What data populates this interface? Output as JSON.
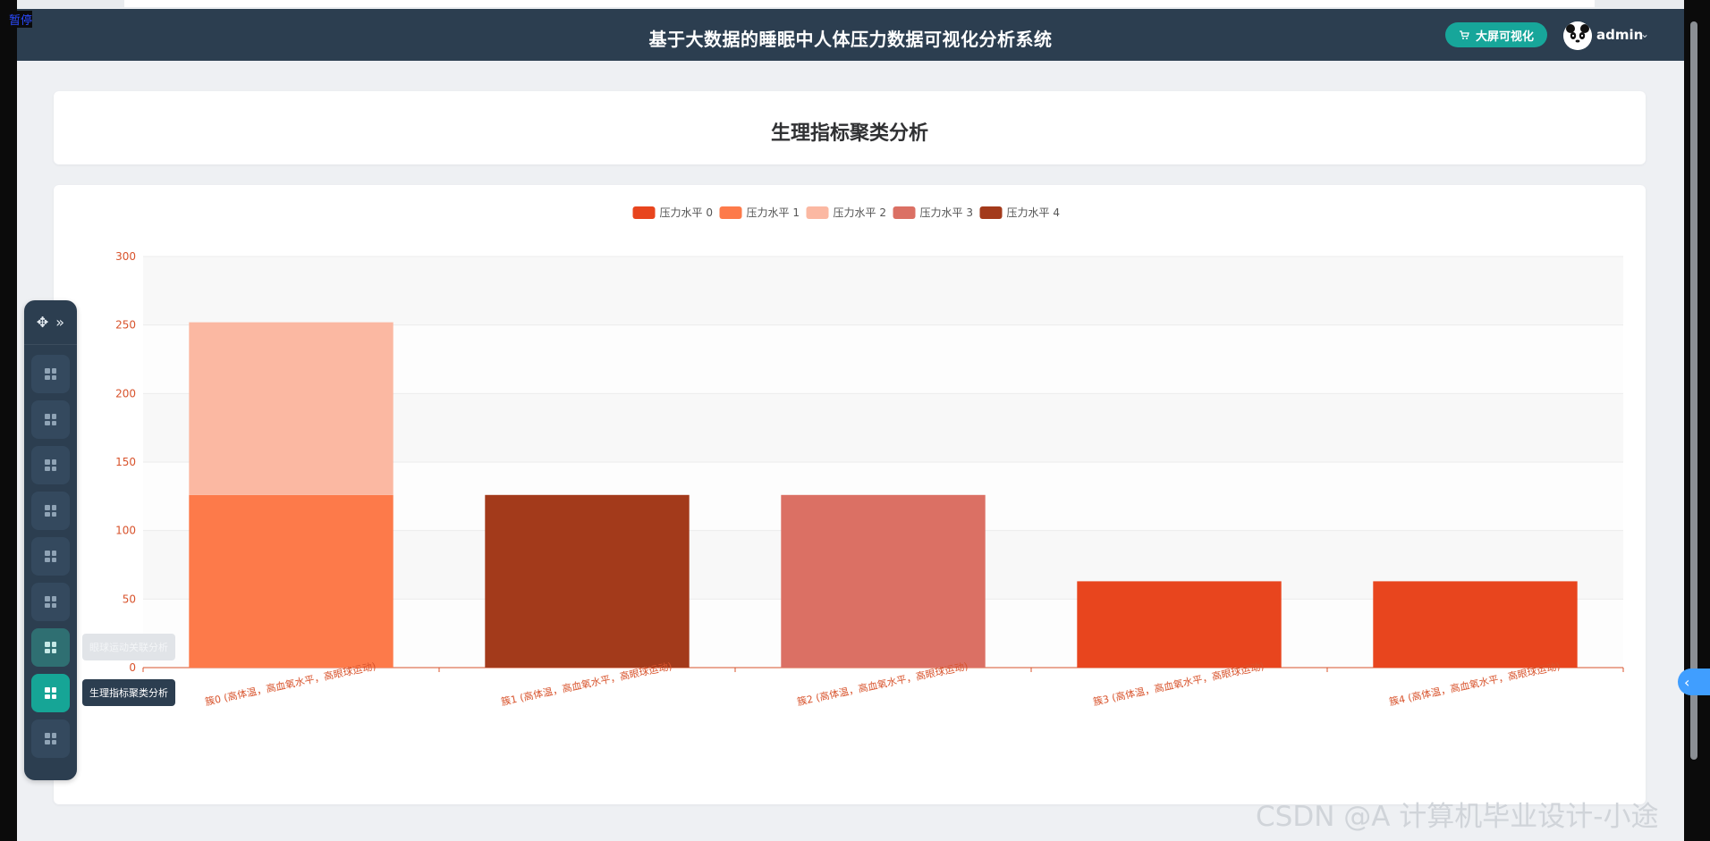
{
  "overlay": {
    "pause_label": "暂停",
    "watermark": "CSDN @A 计算机毕业设计-小途"
  },
  "header": {
    "title": "基于大数据的睡眠中人体压力数据可视化分析系统",
    "bigscreen_button": "大屏可视化",
    "user_name": "admin"
  },
  "page": {
    "title": "生理指标聚类分析"
  },
  "sidebar": {
    "items": [
      {
        "icon": "grid-icon"
      },
      {
        "icon": "grid-icon"
      },
      {
        "icon": "grid-icon"
      },
      {
        "icon": "grid-icon"
      },
      {
        "icon": "grid-icon"
      },
      {
        "icon": "grid-icon"
      },
      {
        "icon": "grid-icon",
        "tooltip": "眼球运动关联分析"
      },
      {
        "icon": "grid-icon",
        "tooltip": "生理指标聚类分析",
        "active": true
      },
      {
        "icon": "grid-icon"
      }
    ]
  },
  "chart_data": {
    "type": "bar",
    "stacked": true,
    "categories": [
      "簇0 (高体温，高血氧水平，高眼球运动)",
      "簇1 (高体温，高血氧水平，高眼球运动)",
      "簇2 (高体温，高血氧水平，高眼球运动)",
      "簇3 (高体温，高血氧水平，高眼球运动)",
      "簇4 (高体温，高血氧水平，高眼球运动)"
    ],
    "series": [
      {
        "name": "压力水平 0",
        "color": "#e8451e",
        "values": [
          0,
          0,
          0,
          63,
          63
        ]
      },
      {
        "name": "压力水平 1",
        "color": "#fd7a4a",
        "values": [
          126,
          0,
          0,
          0,
          0
        ]
      },
      {
        "name": "压力水平 2",
        "color": "#fbb8a2",
        "values": [
          126,
          0,
          0,
          0,
          0
        ]
      },
      {
        "name": "压力水平 3",
        "color": "#db7064",
        "values": [
          0,
          0,
          126,
          0,
          0
        ]
      },
      {
        "name": "压力水平 4",
        "color": "#a33a1b",
        "values": [
          0,
          126,
          0,
          0,
          0
        ]
      }
    ],
    "ylim": [
      0,
      300
    ],
    "yticks": [
      0,
      50,
      100,
      150,
      200,
      250,
      300
    ],
    "legend_position": "top-center",
    "grid": true,
    "axis_color": "#d8532c"
  }
}
